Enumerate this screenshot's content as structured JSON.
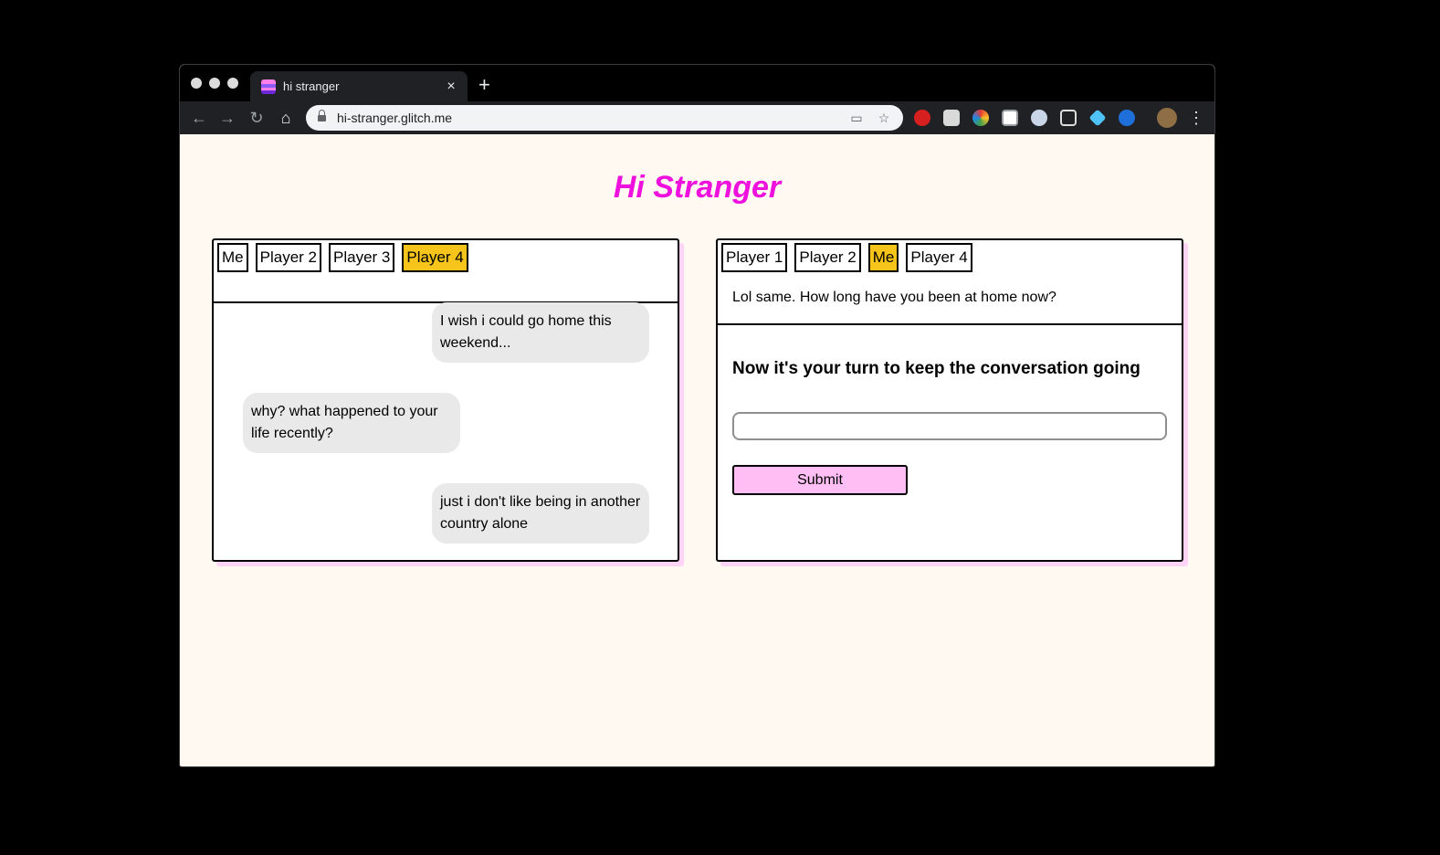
{
  "browser": {
    "tab_title": "hi stranger",
    "tab_close": "×",
    "new_tab": "+",
    "url": "hi-stranger.glitch.me",
    "nav": {
      "back": "←",
      "forward": "→",
      "reload": "↻",
      "home": "⌂"
    },
    "omnibox_icons": {
      "cast": "▭",
      "bookmark": "☆"
    },
    "menu": "⋮"
  },
  "page": {
    "title": "Hi Stranger"
  },
  "left_panel": {
    "players": [
      {
        "label": "Me",
        "active": false
      },
      {
        "label": "Player 2",
        "active": false
      },
      {
        "label": "Player 3",
        "active": false
      },
      {
        "label": "Player 4",
        "active": true
      }
    ],
    "messages": [
      {
        "text": "I wish i could go home this weekend...",
        "side": "right"
      },
      {
        "text": "why? what happened to your life recently?",
        "side": "left"
      },
      {
        "text": "just i don't like being in another country alone",
        "side": "right"
      }
    ]
  },
  "right_panel": {
    "players": [
      {
        "label": "Player 1",
        "active": false
      },
      {
        "label": "Player 2",
        "active": false
      },
      {
        "label": "Me",
        "active": true
      },
      {
        "label": "Player 4",
        "active": false
      }
    ],
    "last_message": "Lol same. How long have you been at home now?",
    "prompt": "Now it's your turn to keep the conversation going",
    "input_value": "",
    "submit_label": "Submit"
  },
  "colors": {
    "accent_title": "#ee11dd",
    "active_player": "#f6c41a",
    "submit_bg": "#ffbff5",
    "panel_shadow": "#ffd3f6",
    "page_bg": "#fff9f2"
  }
}
